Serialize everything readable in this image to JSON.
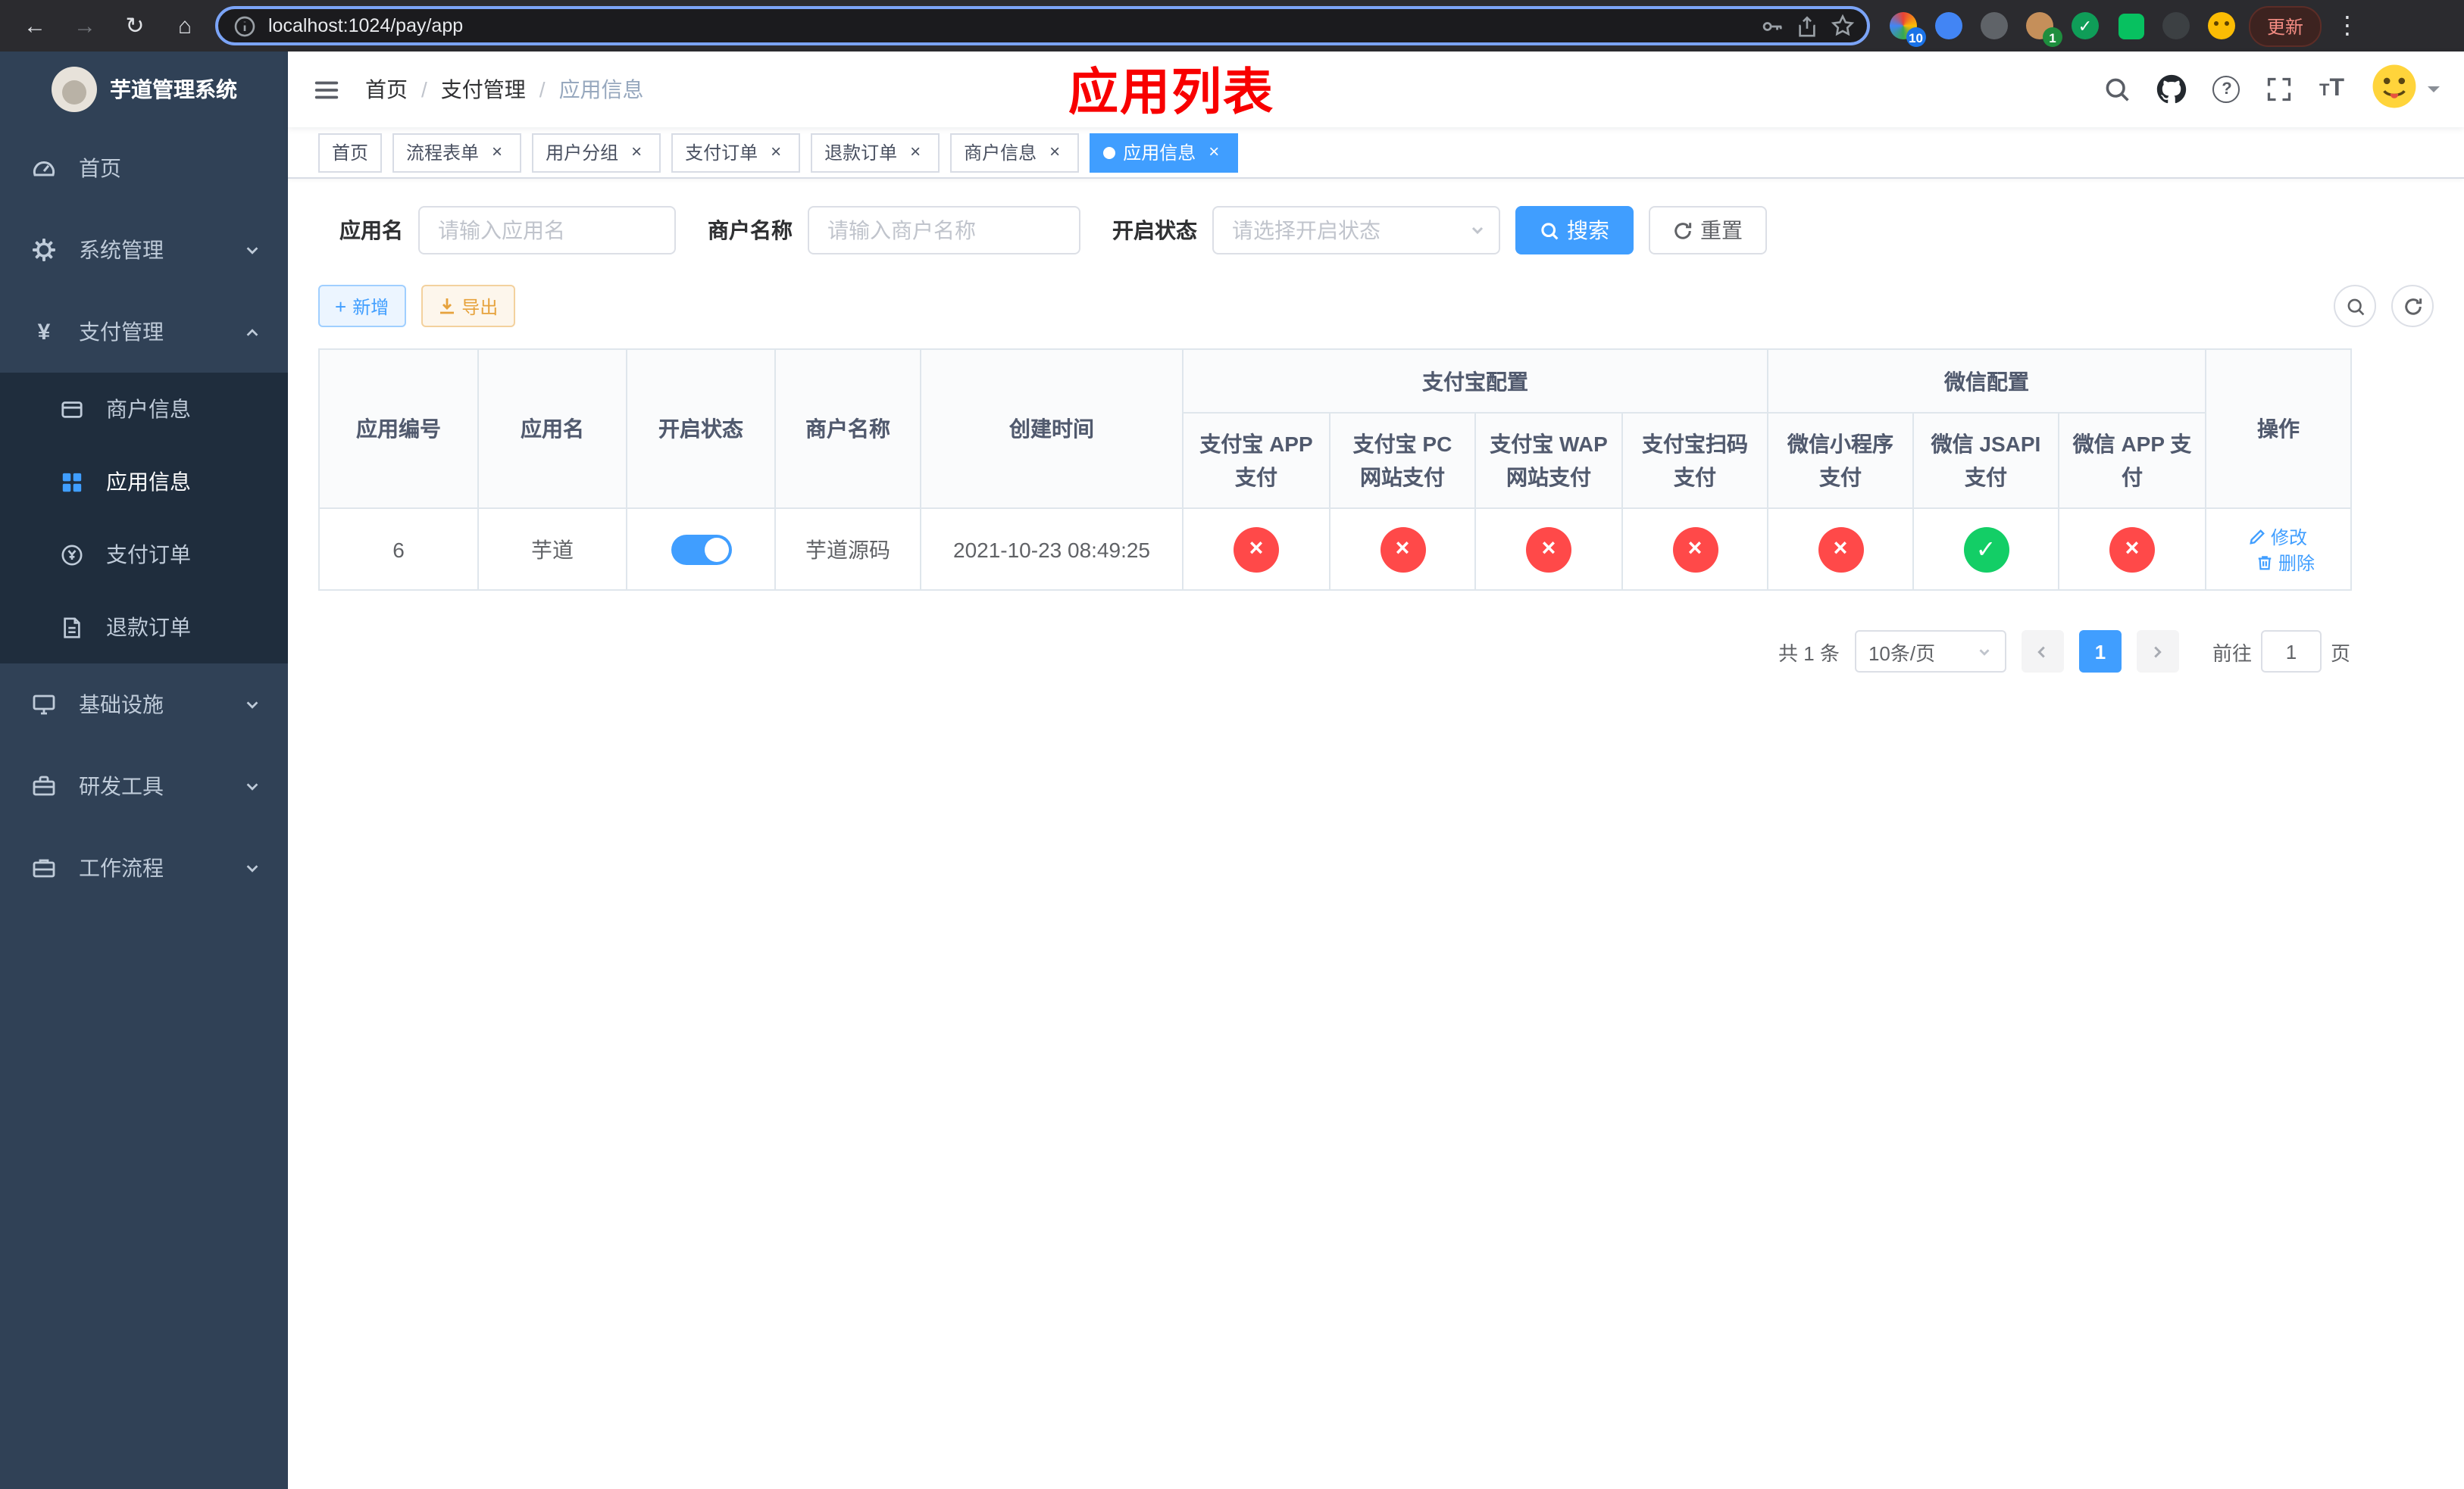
{
  "browser": {
    "url": "localhost:1024/pay/app",
    "update_label": "更新",
    "ext_badge_blue": "10",
    "ext_badge_green": "1"
  },
  "icons": {
    "back": "←",
    "forward": "→",
    "reload": "↻",
    "home": "⌂",
    "kebab": "⋮",
    "plus": "+",
    "close": "×",
    "yen": "¥",
    "check": "✓",
    "cross": "×",
    "ext_check": "✓"
  },
  "sidebar": {
    "title": "芋道管理系统",
    "items": [
      {
        "label": "首页"
      },
      {
        "label": "系统管理"
      },
      {
        "label": "支付管理"
      },
      {
        "label": "基础设施"
      },
      {
        "label": "研发工具"
      },
      {
        "label": "工作流程"
      }
    ],
    "payment_children": [
      {
        "label": "商户信息"
      },
      {
        "label": "应用信息",
        "active": true
      },
      {
        "label": "支付订单"
      },
      {
        "label": "退款订单"
      }
    ]
  },
  "navbar": {
    "breadcrumb": [
      "首页",
      "支付管理",
      "应用信息"
    ],
    "breadcrumb_separator": "/",
    "page_title": "应用列表"
  },
  "tabs": [
    {
      "label": "首页",
      "closable": false
    },
    {
      "label": "流程表单",
      "closable": true
    },
    {
      "label": "用户分组",
      "closable": true
    },
    {
      "label": "支付订单",
      "closable": true
    },
    {
      "label": "退款订单",
      "closable": true
    },
    {
      "label": "商户信息",
      "closable": true
    },
    {
      "label": "应用信息",
      "closable": true,
      "active": true
    }
  ],
  "filters": {
    "app_name_label": "应用名",
    "app_name_placeholder": "请输入应用名",
    "merchant_label": "商户名称",
    "merchant_placeholder": "请输入商户名称",
    "status_label": "开启状态",
    "status_placeholder": "请选择开启状态",
    "search_label": "搜索",
    "reset_label": "重置"
  },
  "toolbar": {
    "add_label": "新增",
    "export_label": "导出"
  },
  "table": {
    "group_alipay": "支付宝配置",
    "group_wechat": "微信配置",
    "columns": [
      "应用编号",
      "应用名",
      "开启状态",
      "商户名称",
      "创建时间",
      "支付宝 APP 支付",
      "支付宝 PC 网站支付",
      "支付宝 WAP 网站支付",
      "支付宝扫码支付",
      "微信小程序支付",
      "微信 JSAPI 支付",
      "微信 APP 支付",
      "操作"
    ],
    "rows": [
      {
        "id": "6",
        "name": "芋道",
        "enabled": true,
        "merchant": "芋道源码",
        "created_at": "2021-10-23 08:49:25",
        "statuses": [
          "no",
          "no",
          "no",
          "no",
          "no",
          "yes",
          "no"
        ],
        "edit_label": "修改",
        "delete_label": "删除"
      }
    ]
  },
  "pagination": {
    "total_text": "共 1 条",
    "page_size": "10条/页",
    "current_page": "1",
    "goto_prefix": "前往",
    "goto_value": "1",
    "goto_suffix": "页"
  },
  "colors": {
    "primary": "#409eff",
    "danger": "#ff4949",
    "success": "#13ce66",
    "warning": "#e6a23c",
    "sidebar_bg": "#304156",
    "submenu_bg": "#1f2d3d",
    "title_red": "#f80000"
  }
}
